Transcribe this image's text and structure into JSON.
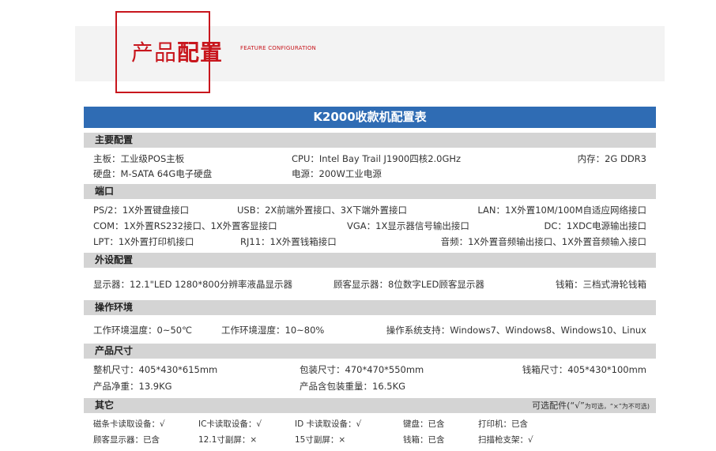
{
  "banner": {
    "title_a": "产品",
    "title_b": "配置",
    "subtitle": "FEATURE CONFIGURATION"
  },
  "table_title": "K2000收款机配置表",
  "sections": {
    "main": {
      "title": "主要配置",
      "r1": {
        "a": "主板：工业级POS主板",
        "b": "CPU：Intel Bay Trail J1900四核2.0GHz",
        "c": "内存：2G DDR3"
      },
      "r2": {
        "a": "硬盘：M-SATA 64G电子硬盘",
        "b": "电源：200W工业电源"
      }
    },
    "ports": {
      "title": "端口",
      "r1": {
        "a": "PS/2：1X外置键盘接口",
        "b": "USB：2X前端外置接口、3X下端外置接口",
        "c": "LAN：1X外置10M/100M自适应网络接口"
      },
      "r2": {
        "a": "COM：1X外置RS232接口、1X外置客显接口",
        "b": "VGA：1X显示器信号输出接口",
        "c": "DC：1XDC电源输出接口"
      },
      "r3": {
        "a": "LPT：1X外置打印机接口",
        "b": "RJ11：1X外置钱箱接口",
        "c": "音频：1X外置音频输出接口、1X外置音频输入接口"
      }
    },
    "peripherals": {
      "title": "外设配置",
      "r1": {
        "a": "显示器：12.1\"LED 1280*800分辨率液晶显示器",
        "b": "顾客显示器：8位数字LED顾客显示器",
        "c": "钱箱：三档式滑轮钱箱"
      }
    },
    "env": {
      "title": "操作环境",
      "r1": {
        "a": "工作环境温度：0~50℃",
        "b": "工作环境湿度：10~80%",
        "c": "操作系统支持：Windows7、Windows8、Windows10、Linux"
      }
    },
    "size": {
      "title": "产品尺寸",
      "r1": {
        "a": "整机尺寸：405*430*615mm",
        "b": "包装尺寸：470*470*550mm",
        "c": "钱箱尺寸：405*430*100mm"
      },
      "r2": {
        "a": "产品净重：13.9KG",
        "b": "产品含包装重量：16.5KG"
      }
    },
    "other": {
      "title": "其它",
      "note_a": "可选配件(“√”",
      "note_b": "为可选，“×”为不可选)",
      "r1": {
        "a": "磁条卡读取设备：√",
        "b": "IC卡读取设备：√",
        "c": "ID 卡读取设备：√",
        "d": "键盘：已含",
        "e": "打印机：已含"
      },
      "r2": {
        "a": "顾客显示器：已含",
        "b": "12.1寸副屏：×",
        "c": "15寸副屏：×",
        "d": "钱箱：已含",
        "e": "扫描枪支架：√"
      }
    }
  }
}
